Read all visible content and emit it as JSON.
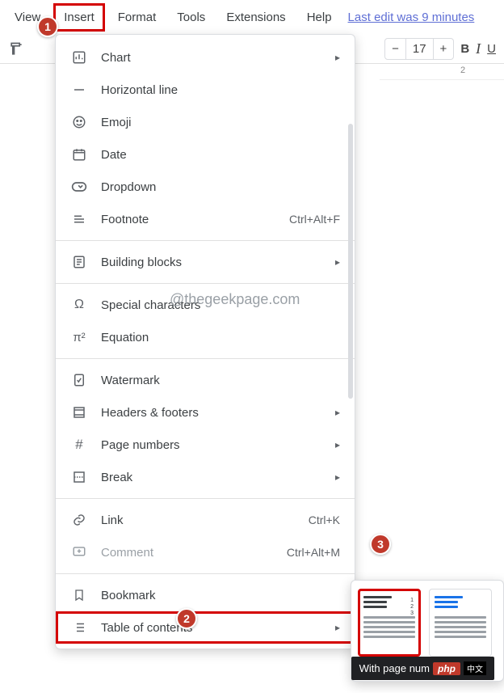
{
  "menubar": {
    "view": "View",
    "insert": "Insert",
    "format": "Format",
    "tools": "Tools",
    "extensions": "Extensions",
    "help": "Help",
    "lastedit": "Last edit was 9 minutes"
  },
  "toolbar": {
    "fontsize_minus": "−",
    "fontsize_value": "17",
    "fontsize_plus": "+",
    "bold": "B",
    "italic": "I",
    "underline": "U"
  },
  "ruler": {
    "tick2": "2"
  },
  "insert_menu": {
    "chart": "Chart",
    "hline": "Horizontal line",
    "emoji": "Emoji",
    "date": "Date",
    "dropdown": "Dropdown",
    "footnote": "Footnote",
    "footnote_sc": "Ctrl+Alt+F",
    "building_blocks": "Building blocks",
    "special_chars": "Special characters",
    "equation": "Equation",
    "watermark": "Watermark",
    "headers_footers": "Headers & footers",
    "page_numbers": "Page numbers",
    "break": "Break",
    "link": "Link",
    "link_sc": "Ctrl+K",
    "comment": "Comment",
    "comment_sc": "Ctrl+Alt+M",
    "bookmark": "Bookmark",
    "toc": "Table of contents"
  },
  "watermark_overlay": "@thegeekpage.com",
  "submenu": {
    "tooltip": "With page num"
  },
  "footer": {
    "php": "php",
    "cn": "中文"
  },
  "badges": {
    "b1": "1",
    "b2": "2",
    "b3": "3"
  }
}
